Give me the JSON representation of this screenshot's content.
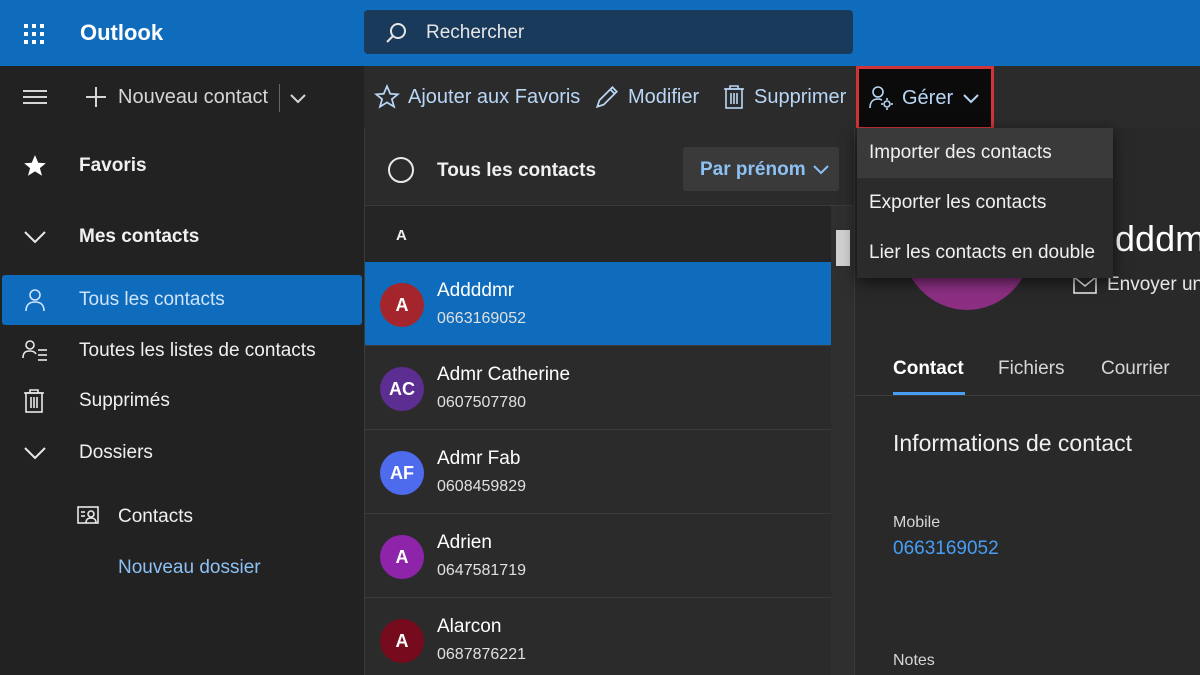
{
  "topbar": {
    "app_title": "Outlook",
    "search_placeholder": "Rechercher",
    "launcher_icon": "waffle-icon",
    "color": "#0f6cbd"
  },
  "commandbar": {
    "new_contact": "Nouveau contact",
    "add_favorites": "Ajouter aux Favoris",
    "edit": "Modifier",
    "delete": "Supprimer",
    "manage": "Gérer"
  },
  "manage_menu": {
    "items": [
      {
        "label": "Importer des contacts"
      },
      {
        "label": "Exporter les contacts"
      },
      {
        "label": "Lier les contacts en double"
      }
    ]
  },
  "nav": {
    "favorites": "Favoris",
    "my_contacts": "Mes contacts",
    "all_contacts": "Tous les contacts",
    "all_lists": "Toutes les listes de contacts",
    "deleted": "Supprimés",
    "folders": "Dossiers",
    "contacts_folder": "Contacts",
    "new_folder": "Nouveau dossier"
  },
  "list": {
    "title": "Tous les contacts",
    "sort_label": "Par prénom",
    "letter": "A",
    "contacts": [
      {
        "initials": "A",
        "name": "Addddmr",
        "phone": "0663169052",
        "color": "#a4262c",
        "selected": true
      },
      {
        "initials": "AC",
        "name": "Admr Catherine",
        "phone": "0607507780",
        "color": "#5c2e91",
        "selected": false
      },
      {
        "initials": "AF",
        "name": "Admr Fab",
        "phone": "0608459829",
        "color": "#4f6bed",
        "selected": false
      },
      {
        "initials": "A",
        "name": "Adrien",
        "phone": "0647581719",
        "color": "#8e24aa",
        "selected": false
      },
      {
        "initials": "A",
        "name": "Alarcon",
        "phone": "0687876221",
        "color": "#750b1c",
        "selected": false
      }
    ]
  },
  "detail": {
    "name": "Addddm",
    "send_mail": "Envoyer un",
    "tabs": [
      "Contact",
      "Fichiers",
      "Courrier"
    ],
    "section_title": "Informations de contact",
    "mobile_label": "Mobile",
    "mobile_value": "0663169052",
    "notes_label": "Notes",
    "avatar_color": "#8c2f82"
  },
  "colors": {
    "accent": "#0f6cbd",
    "link": "#479ef5",
    "highlight_border": "#d13438"
  }
}
